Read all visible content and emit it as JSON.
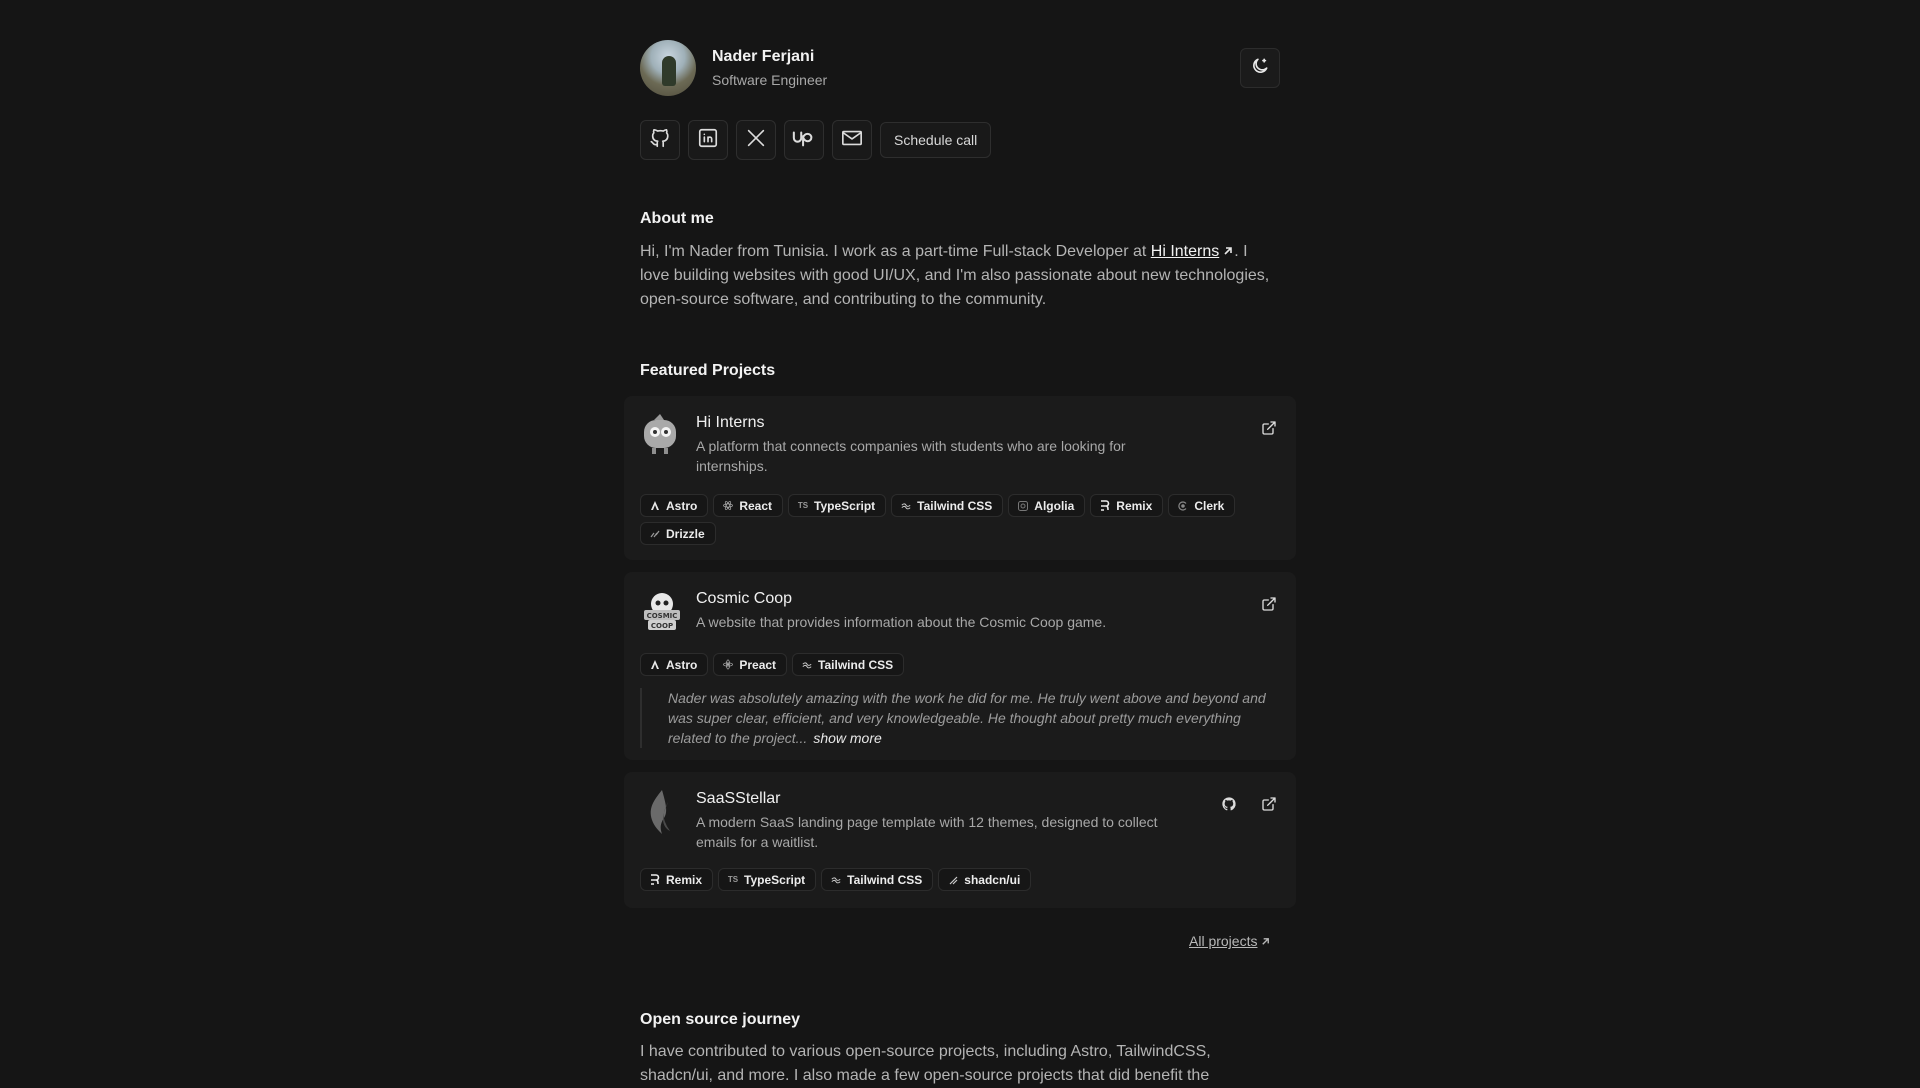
{
  "profile": {
    "name": "Nader Ferjani",
    "role": "Software Engineer"
  },
  "socials": {
    "schedule_label": "Schedule call"
  },
  "about": {
    "title": "About me",
    "text_before": "Hi, I'm Nader from Tunisia. I work as a part-time Full-stack Developer at ",
    "link": "Hi Interns",
    "text_after": ". I love building websites with good UI/UX, and I'm also passionate about new technologies, open-source software, and contributing to the community."
  },
  "projects": {
    "title": "Featured Projects",
    "items": [
      {
        "name": "Hi Interns",
        "description": "A platform that connects companies with students who are looking for internships.",
        "tags": [
          "Astro",
          "React",
          "TypeScript",
          "Tailwind CSS",
          "Algolia",
          "Remix",
          "Clerk",
          "Drizzle"
        ]
      },
      {
        "name": "Cosmic Coop",
        "description": "A website that provides information about the Cosmic Coop game.",
        "tags": [
          "Astro",
          "Preact",
          "Tailwind CSS"
        ],
        "testimonial": "Nader was absolutely amazing with the work he did for me. He truly went above and beyond and was super clear, efficient, and very knowledgeable. He thought about pretty much everything related to the project...",
        "show_more": "show more"
      },
      {
        "name": "SaaSStellar",
        "description": "A modern SaaS landing page template with 12 themes, designed to collect emails for a waitlist.",
        "tags": [
          "Remix",
          "TypeScript",
          "Tailwind CSS",
          "shadcn/ui"
        ]
      }
    ],
    "all_projects_label": "All projects"
  },
  "opensource": {
    "title": "Open source journey",
    "text": "I have contributed to various open-source projects, including Astro, TailwindCSS, shadcn/ui, and more. I also made a few open-source projects that did benefit the"
  }
}
